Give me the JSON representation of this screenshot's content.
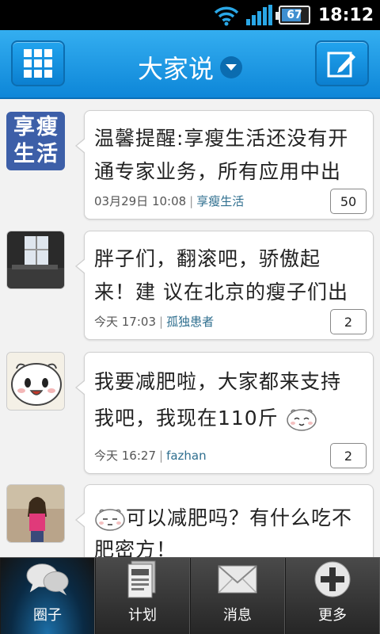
{
  "status_bar": {
    "battery": "67",
    "battery_level_pct": 67,
    "time": "18:12"
  },
  "header": {
    "title": "大家说",
    "left_button_icon": "grid-menu-icon",
    "right_button_icon": "compose-icon"
  },
  "posts": [
    {
      "avatar_text": "享瘦生活",
      "text": "温馨提醒:享瘦生活还没有开通专家业务，所有应用中出",
      "date": "03月29日 10:08",
      "author": "享瘦生活",
      "count": "50"
    },
    {
      "avatar_text": "",
      "text": "胖子们，翻滚吧，骄傲起来！建 议在北京的瘦子们出",
      "date": "今天 17:03",
      "author": "孤独患者",
      "count": "2"
    },
    {
      "avatar_text": "",
      "text": "我要减肥啦，大家都来支持我吧，我现在110斤",
      "date": "今天 16:27",
      "author": "fazhan",
      "count": "2"
    },
    {
      "avatar_text": "",
      "text": "可以减肥吗？有什么吃不肥密方！",
      "date": "",
      "author": "",
      "count": ""
    }
  ],
  "tabs": [
    {
      "label": "圈子",
      "icon": "chat-bubbles-icon",
      "active": true
    },
    {
      "label": "计划",
      "icon": "document-icon",
      "active": false
    },
    {
      "label": "消息",
      "icon": "envelope-icon",
      "active": false
    },
    {
      "label": "更多",
      "icon": "plus-circle-icon",
      "active": false
    }
  ],
  "colors": {
    "header_blue": "#1a9be6",
    "author_link": "#2f6f8f",
    "tab_active": "#1c6fa8"
  }
}
